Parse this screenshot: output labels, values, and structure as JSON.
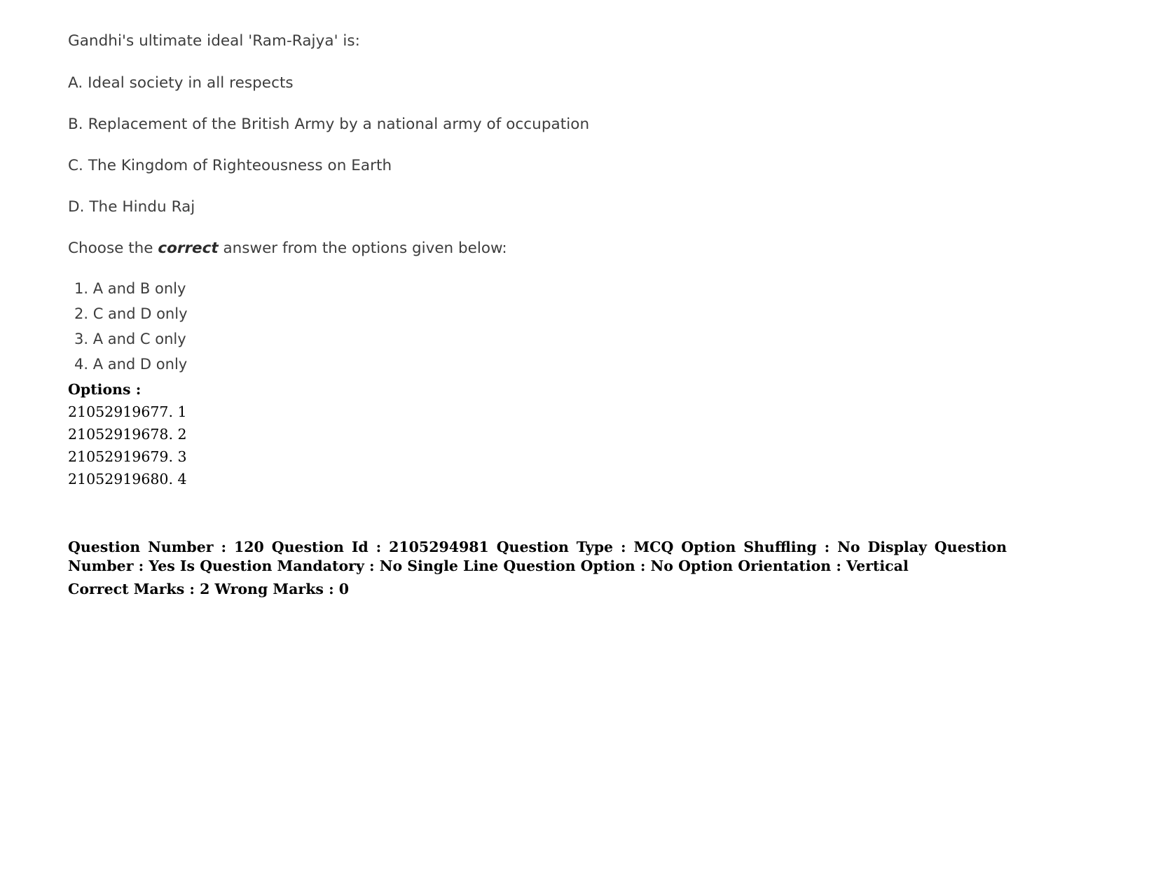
{
  "document": {
    "type": "exam-question-sheet",
    "text_color": "#3d3d3d",
    "meta_color": "#000000",
    "background": "#ffffff"
  },
  "question": {
    "stem": "Gandhi's ultimate ideal 'Ram-Rajya' is:",
    "statements": [
      "A. Ideal society in all respects",
      "B. Replacement of the British Army by a national army of occupation",
      "C. The Kingdom of Righteousness on Earth",
      "D. The Hindu Raj"
    ],
    "choose_prefix": "Choose the ",
    "choose_emphasis": "correct",
    "choose_suffix": " answer from the options given below:",
    "answers": [
      "1. A and B only",
      "2. C and D only",
      "3. A and C only",
      "4. A and D only"
    ]
  },
  "options": {
    "heading": "Options :",
    "items": [
      "21052919677. 1",
      "21052919678. 2",
      "21052919679. 3",
      "21052919680. 4"
    ]
  },
  "meta": {
    "line1": "Question Number : 120 Question Id : 2105294981 Question Type : MCQ Option Shuffling : No Display Question Number : Yes Is Question Mandatory : No Single Line Question Option : No Option Orientation : Vertical",
    "line2": "Correct Marks : 2 Wrong Marks : 0"
  }
}
